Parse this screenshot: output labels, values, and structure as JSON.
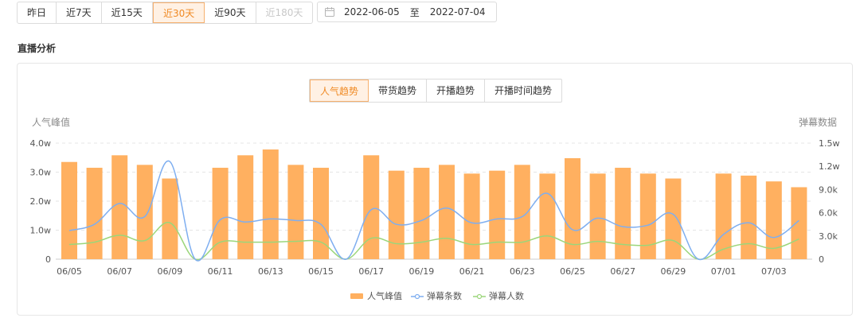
{
  "range_tabs": [
    {
      "label": "昨日",
      "state": "normal"
    },
    {
      "label": "近7天",
      "state": "normal"
    },
    {
      "label": "近15天",
      "state": "normal"
    },
    {
      "label": "近30天",
      "state": "active"
    },
    {
      "label": "近90天",
      "state": "normal"
    },
    {
      "label": "近180天",
      "state": "disabled"
    }
  ],
  "date_range": {
    "start": "2022-06-05",
    "separator": "至",
    "end": "2022-07-04"
  },
  "section_title": "直播分析",
  "chart_tabs": [
    {
      "label": "人气趋势",
      "active": true
    },
    {
      "label": "带货趋势",
      "active": false
    },
    {
      "label": "开播趋势",
      "active": false
    },
    {
      "label": "开播时间趋势",
      "active": false
    }
  ],
  "colors": {
    "accent": "#f08a24",
    "bar": "#ffb060",
    "line_comments": "#7eaef0",
    "line_people": "#9bd67a"
  },
  "chart_data": {
    "type": "bar",
    "x": [
      "06/05",
      "06/06",
      "06/07",
      "06/08",
      "06/09",
      "06/10",
      "06/11",
      "06/12",
      "06/13",
      "06/14",
      "06/15",
      "06/16",
      "06/17",
      "06/18",
      "06/19",
      "06/20",
      "06/21",
      "06/22",
      "06/23",
      "06/24",
      "06/25",
      "06/26",
      "06/27",
      "06/28",
      "06/29",
      "06/30",
      "07/01",
      "07/02",
      "07/03",
      "07/04"
    ],
    "x_tick_labels": [
      "06/05",
      "06/07",
      "06/09",
      "06/11",
      "06/13",
      "06/15",
      "06/17",
      "06/19",
      "06/21",
      "06/23",
      "06/25",
      "06/27",
      "06/29",
      "07/01",
      "07/03"
    ],
    "left_axis": {
      "title": "人气峰值",
      "ticks": [
        "0",
        "1.0w",
        "2.0w",
        "3.0w",
        "4.0w"
      ],
      "ylim": [
        0,
        40000
      ]
    },
    "right_axis": {
      "title": "弹幕数据",
      "ticks": [
        "0",
        "3.0k",
        "6.0k",
        "9.0k",
        "1.2w",
        "1.5w"
      ],
      "ylim": [
        0,
        15000
      ]
    },
    "series": [
      {
        "name": "人气峰值",
        "type": "bar",
        "axis": "left",
        "values": [
          33500,
          31500,
          35800,
          32500,
          27800,
          0,
          31500,
          35800,
          37800,
          32500,
          31500,
          0,
          35800,
          30500,
          31500,
          32500,
          29500,
          30500,
          32500,
          29500,
          34800,
          29500,
          31500,
          29500,
          27800,
          0,
          29500,
          28800,
          26800,
          24800
        ]
      },
      {
        "name": "弹幕条数",
        "type": "line",
        "axis": "right",
        "values": [
          3700,
          4500,
          7200,
          5500,
          12600,
          0,
          5100,
          4800,
          5200,
          5000,
          4500,
          0,
          6400,
          4500,
          5000,
          6600,
          4700,
          5200,
          5500,
          8500,
          3800,
          5300,
          4200,
          4400,
          5800,
          0,
          3200,
          4700,
          2800,
          5000
        ]
      },
      {
        "name": "弹幕人数",
        "type": "line",
        "axis": "right",
        "values": [
          1900,
          2200,
          3100,
          2400,
          4700,
          0,
          2200,
          2200,
          2200,
          2300,
          2200,
          0,
          2700,
          2000,
          2200,
          2700,
          1900,
          2200,
          2200,
          3000,
          1900,
          2300,
          1900,
          1800,
          2400,
          0,
          1300,
          2000,
          1400,
          2600
        ]
      }
    ],
    "legend_position": "bottom",
    "grid": true
  }
}
